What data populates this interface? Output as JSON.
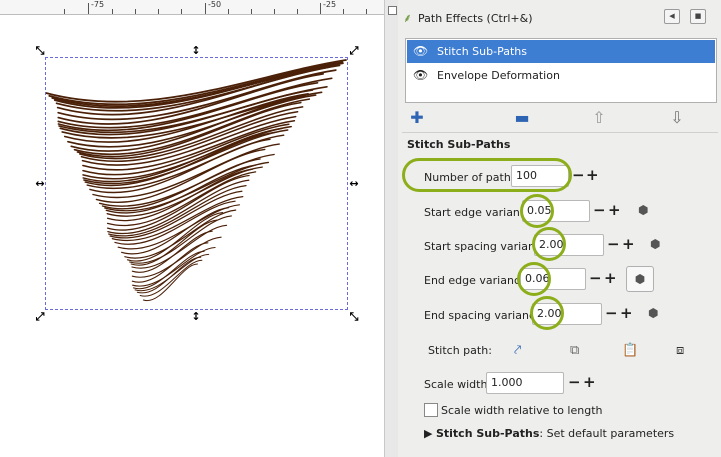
{
  "ruler": {
    "labels": [
      "-75",
      "-50",
      "-25"
    ]
  },
  "panel": {
    "title": "Path Effects (Ctrl+&)",
    "effects": [
      {
        "label": "Stitch Sub-Paths",
        "selected": true
      },
      {
        "label": "Envelope Deformation",
        "selected": false
      }
    ],
    "section_title": "Stitch Sub-Paths",
    "params": {
      "number_of_paths": {
        "label": "Number of paths:",
        "value": "100"
      },
      "start_edge_variance": {
        "label": "Start edge variance:",
        "value": "0.05"
      },
      "start_spacing_variance": {
        "label": "Start spacing variance:",
        "value": "2.00"
      },
      "end_edge_variance": {
        "label": "End edge variance:",
        "value": "0.06"
      },
      "end_spacing_variance": {
        "label": "End spacing variance:",
        "value": "2.00"
      },
      "stitch_path": {
        "label": "Stitch path:"
      },
      "scale_width": {
        "label": "Scale width:",
        "value": "1.000"
      },
      "scale_relative": {
        "label": "Scale width relative to length",
        "checked": false
      }
    },
    "defaults": {
      "bold": "Stitch Sub-Paths",
      "text": ": Set default parameters"
    },
    "plus": "+",
    "minus": "−"
  },
  "colors": {
    "stroke": "#4a2008",
    "accent_ring": "#8dae1b",
    "selection": "#3d7dd2"
  },
  "icons": [
    "eye-icon",
    "add-icon",
    "remove-icon",
    "move-up-icon",
    "move-down-icon",
    "randomize-icon",
    "edit-on-canvas-icon",
    "copy-icon",
    "paste-icon",
    "link-icon"
  ]
}
